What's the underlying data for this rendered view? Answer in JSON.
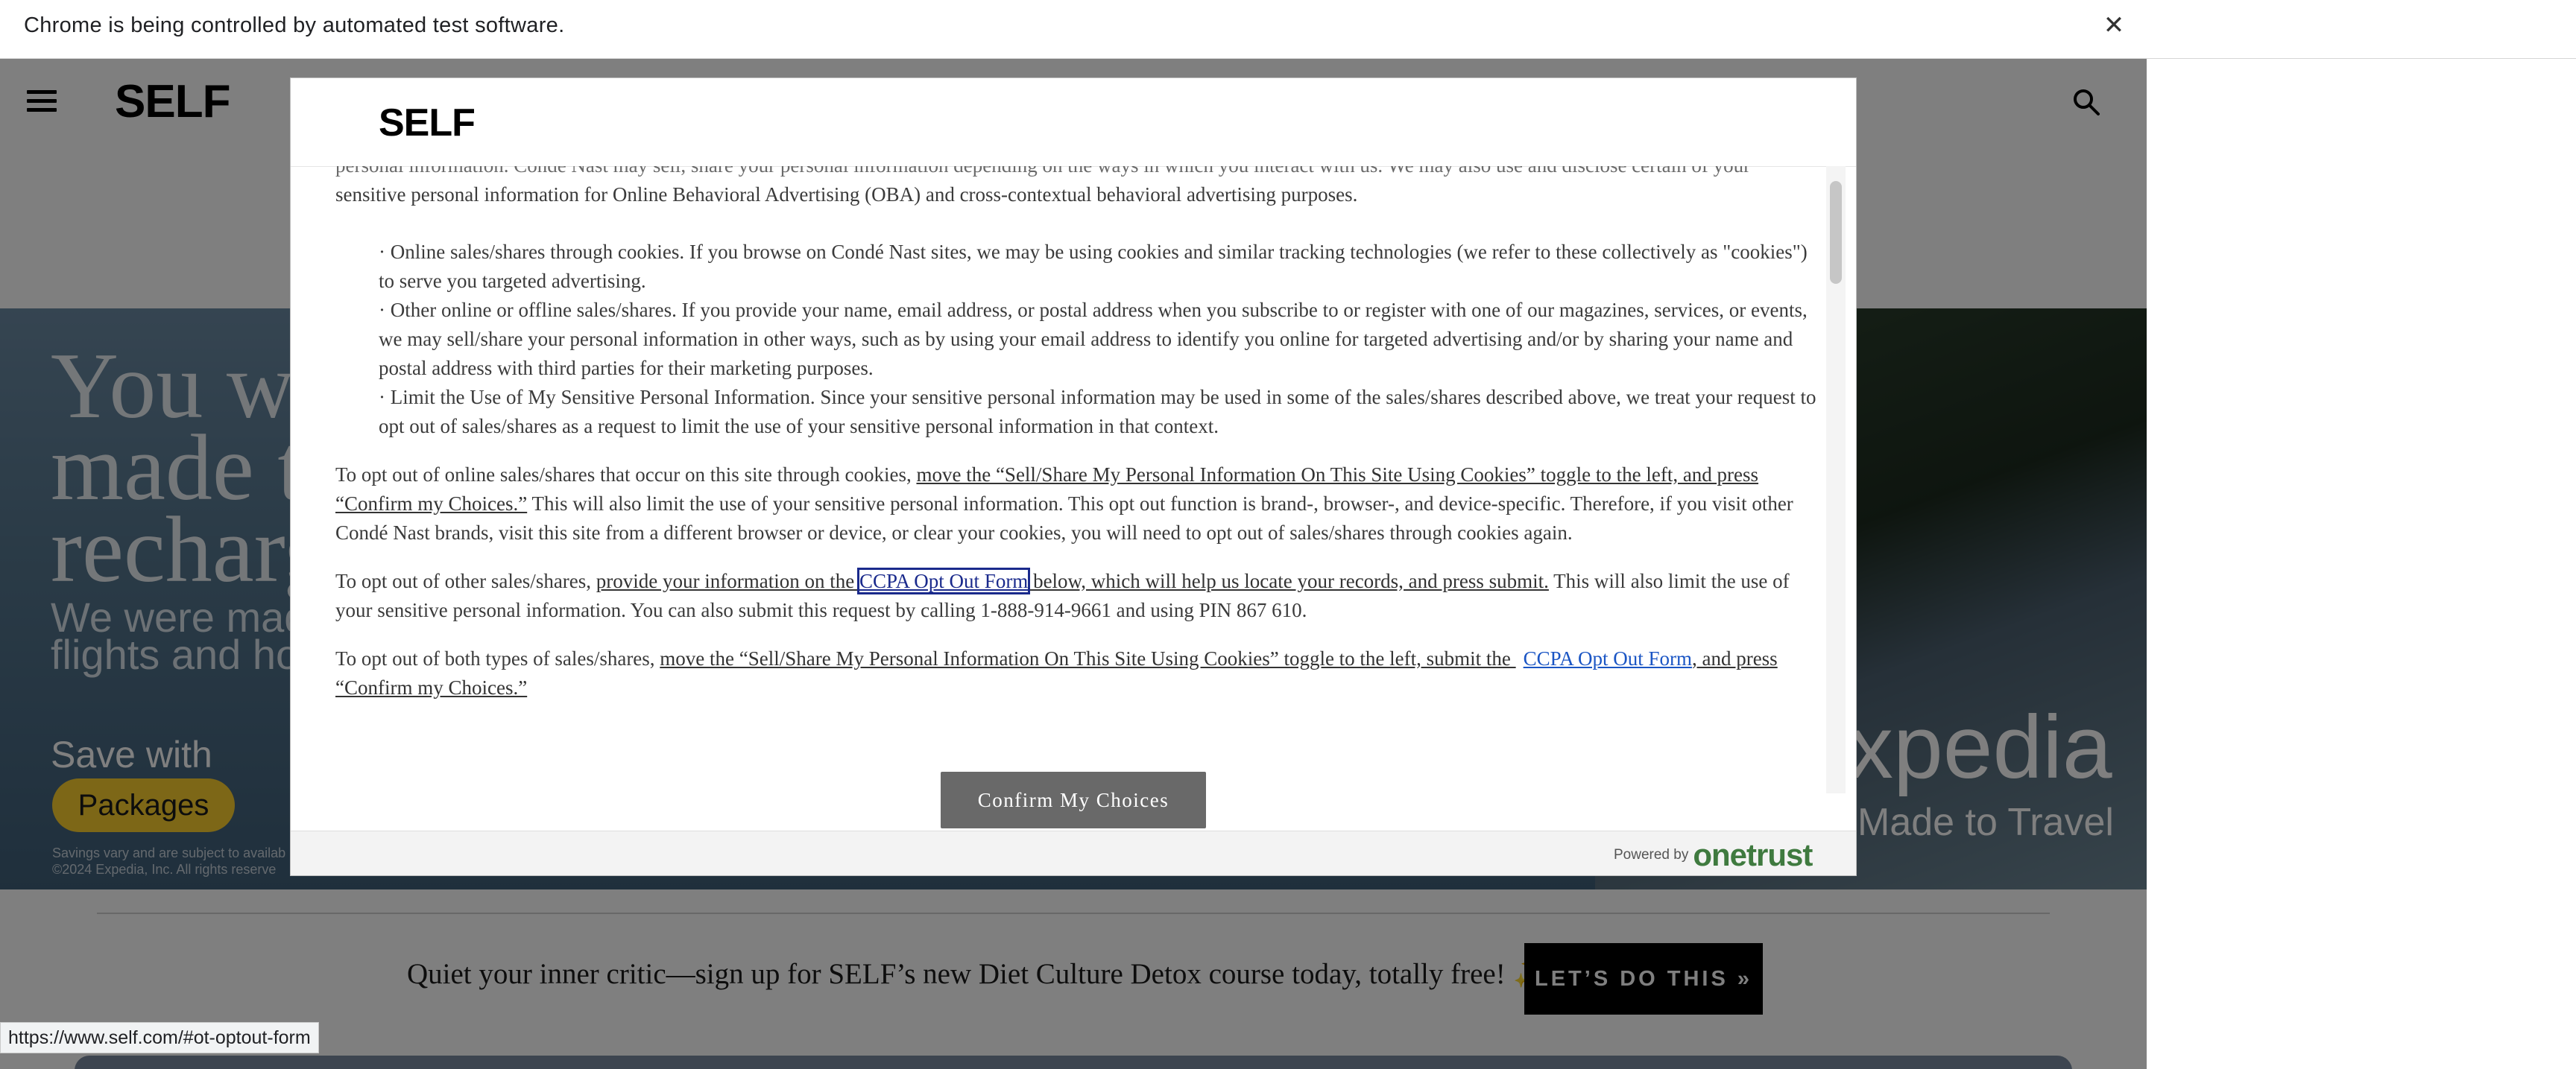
{
  "infobar": {
    "text": "Chrome is being controlled by automated test software.",
    "close": "✕"
  },
  "site": {
    "logo": "SELF"
  },
  "ad": {
    "headline": "You we\nmade t\nrecharg",
    "subline": "We were made\nflights and hote",
    "save": "Save with",
    "button": "Packages",
    "fine_print": "Savings vary and are subject to availab\n©2024 Expedia, Inc. All rights reserve",
    "brand": "xpedia",
    "tagline": "Made to Travel"
  },
  "modal": {
    "logo": "SELF",
    "intro_faded": "personal information. Condé Nast may sell, share your personal information depending on the ways in which you interact with us. We may also use and disclose certain of your",
    "intro": "sensitive personal information for Online Behavioral Advertising (OBA) and cross-contextual behavioral advertising purposes.",
    "bullet1": "· Online sales/shares through cookies. If you browse on Condé Nast sites, we may be using cookies and similar tracking technologies (we refer to these collectively as \"cookies\") to serve you targeted advertising.",
    "bullet2": "· Other online or offline sales/shares. If you provide your name, email address, or postal address when you subscribe to or register with one of our magazines, services, or events, we may sell/share your personal information in other ways, such as by using your email address to identify you online for targeted advertising and/or by sharing your name and postal address with third parties for their marketing purposes.",
    "bullet3": "· Limit the Use of My Sensitive Personal Information. Since your sensitive personal information may be used in some of the sales/shares described above, we treat your request to opt out of sales/shares as a request to limit the use of your sensitive personal information in that context.",
    "p1_a": "To opt out of online sales/shares that occur on this site through cookies, ",
    "p1_link": "move the “Sell/Share My Personal Information On This Site Using Cookies” toggle to the left, and press “Confirm my Choices.”",
    "p1_b": " This will also limit the use of your sensitive personal information. This opt out function is brand-, browser-, and device-specific. Therefore, if you visit other Condé Nast brands, visit this site from a different browser or device, or clear your cookies, you will need to opt out of sales/shares through cookies again.",
    "p2_a": "To opt out of other sales/shares, ",
    "p2_link1": "provide your information on the ",
    "p2_link2": "CCPA Opt Out Form",
    "p2_link3": " below, which will help us locate your records, and press submit.",
    "p2_b": " This will also limit the use of your sensitive personal information. You can also submit this request by calling 1-888-914-9661 and using PIN 867 610.",
    "p3_a": "To opt out of both types of sales/shares, ",
    "p3_link1": "move the “Sell/Share My Personal Information On This Site Using Cookies” toggle to the left, submit the ",
    "p3_link2": "CCPA Opt Out Form",
    "p3_link3": ", and press “Confirm my Choices.”",
    "confirm": "Confirm My Choices",
    "powered_by": "Powered by",
    "powered_brand": "onetrust"
  },
  "promo": {
    "text_a": "Quiet your inner critic—sign up for SELF’s new ",
    "text_b": "Diet Culture Detox course",
    "text_c": " today, totally free! ✨",
    "button": "LET’S DO THIS »"
  },
  "status_url": "https://www.self.com/#ot-optout-form"
}
